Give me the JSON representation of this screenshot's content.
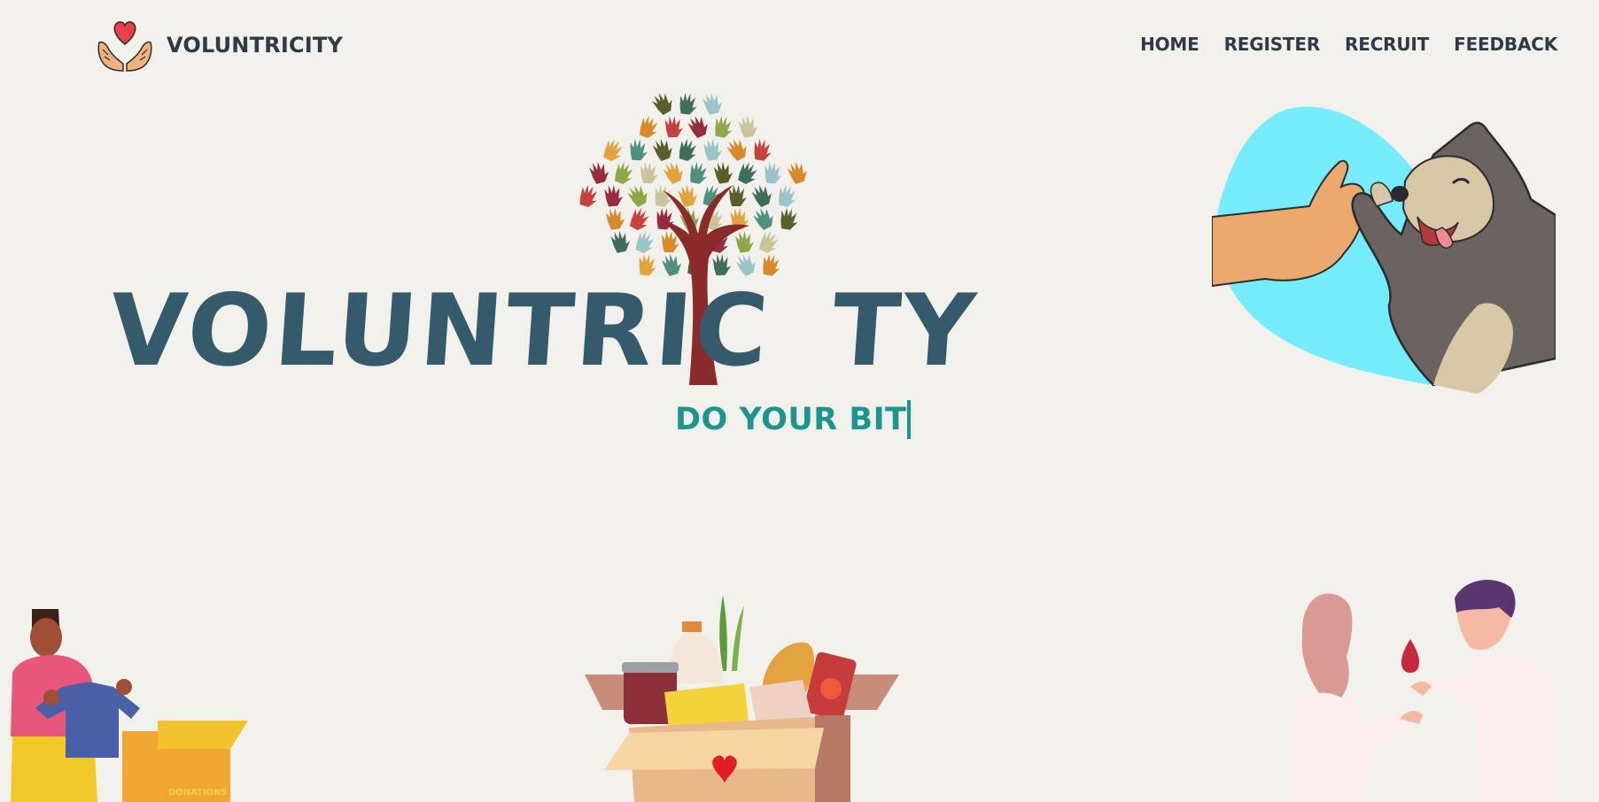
{
  "brand": {
    "name": "VOLUNTRICITY",
    "logo_icon": "hands-heart-icon"
  },
  "nav": {
    "items": [
      {
        "label": "HOME"
      },
      {
        "label": "REGISTER"
      },
      {
        "label": "RECRUIT"
      },
      {
        "label": "FEEDBACK"
      }
    ]
  },
  "hero": {
    "title_part1": "VOLUNTRIC",
    "title_part2": "TY",
    "tagline": "DO YOUR BIT",
    "tree_icon": "hand-tree-icon"
  },
  "illustrations": {
    "top_right": "dog-high-five-icon",
    "bottom_left": "clothes-donation-icon",
    "bottom_center": "food-donation-box-icon",
    "bottom_right": "blood-donation-icon",
    "box_label": "DONATIONS"
  },
  "colors": {
    "background": "#f2f0eb",
    "nav_text": "#2e3a48",
    "title": "#355a6c",
    "tagline": "#1b968f",
    "tree_trunk": "#8b2a2a",
    "sky_blob": "#74ecfb"
  }
}
